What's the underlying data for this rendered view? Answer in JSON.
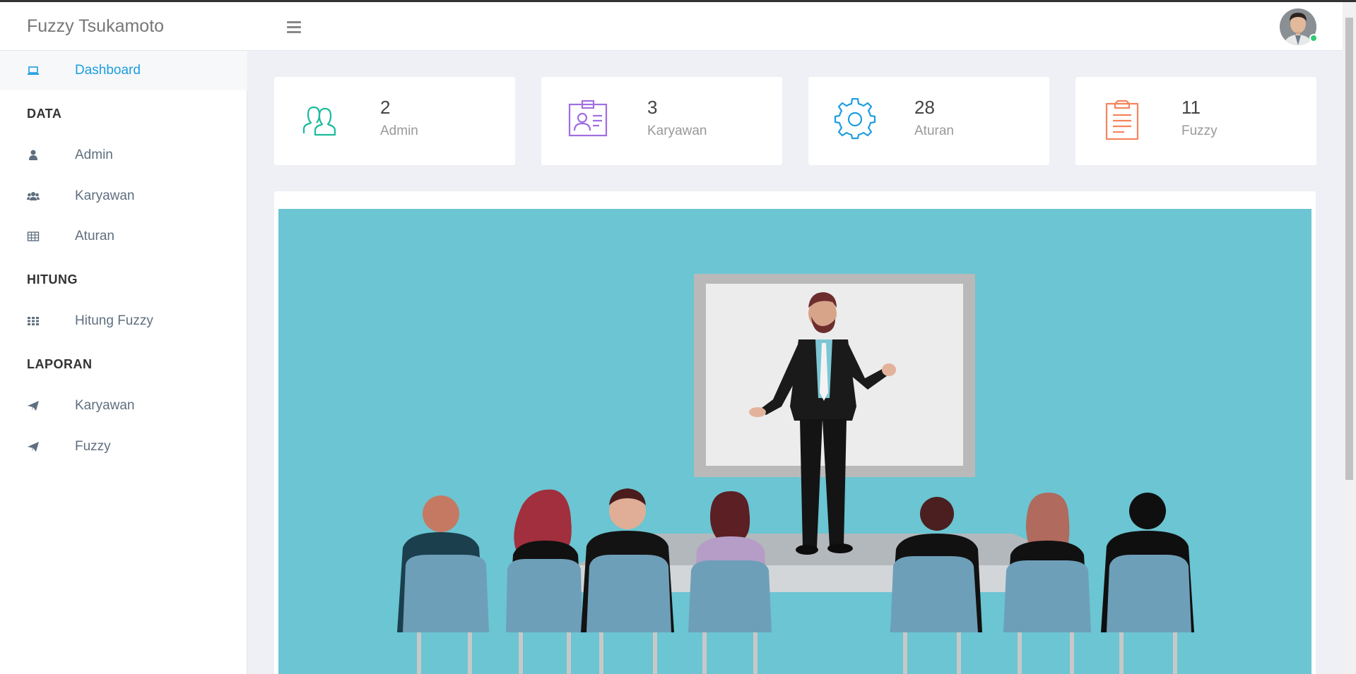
{
  "app": {
    "brand": "Fuzzy Tsukamoto"
  },
  "header": {
    "menu_icon": "hamburger-icon",
    "avatar_icon": "user-avatar",
    "status_color": "#2ecc71"
  },
  "sidebar": {
    "dashboard": {
      "label": "Dashboard",
      "icon": "laptop-icon"
    },
    "sections": [
      "DATA",
      "HITUNG",
      "LAPORAN"
    ],
    "data_items": [
      {
        "label": "Admin",
        "icon": "user-icon"
      },
      {
        "label": "Karyawan",
        "icon": "users-icon"
      },
      {
        "label": "Aturan",
        "icon": "table-icon"
      }
    ],
    "hitung_items": [
      {
        "label": "Hitung Fuzzy",
        "icon": "grid-icon"
      }
    ],
    "laporan_items": [
      {
        "label": "Karyawan",
        "icon": "paper-plane-icon"
      },
      {
        "label": "Fuzzy",
        "icon": "paper-plane-icon"
      }
    ]
  },
  "stats": [
    {
      "value": "2",
      "label": "Admin",
      "icon": "users-outline-icon",
      "color": "#1abc9c"
    },
    {
      "value": "3",
      "label": "Karyawan",
      "icon": "id-card-icon",
      "color": "#a06ee1"
    },
    {
      "value": "28",
      "label": "Aturan",
      "icon": "gear-icon",
      "color": "#1e9de0"
    },
    {
      "value": "11",
      "label": "Fuzzy",
      "icon": "clipboard-icon",
      "color": "#f5845d"
    }
  ],
  "colors": {
    "accent": "#1e9de0",
    "illustration_bg": "#6bc5d2"
  }
}
